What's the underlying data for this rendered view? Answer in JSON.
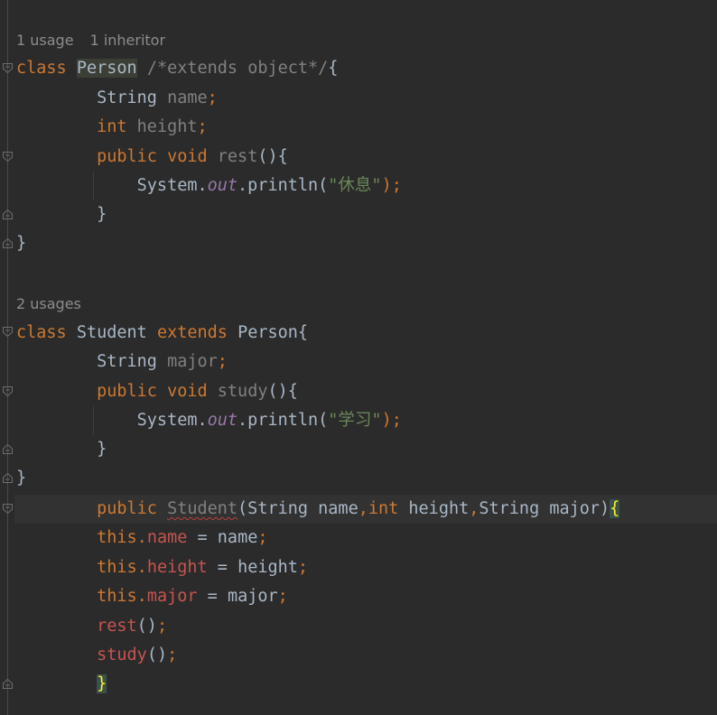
{
  "editor": {
    "inlay_person": {
      "usages": "1 usage",
      "inheritors": "1 inheritor"
    },
    "inlay_student": {
      "usages": "2 usages"
    },
    "code": {
      "class_kw": "class",
      "person": "Person",
      "comment_extends": "/*extends object*/",
      "brace_open": "{",
      "brace_close": "}",
      "string_type": "String",
      "name_field": "name",
      "int_kw": "int",
      "height_field": "height",
      "public_kw": "public",
      "void_kw": "void",
      "rest_method": "rest",
      "study_method": "study",
      "parens_open": "(){",
      "system": "System.",
      "out": "out",
      "println": ".println(",
      "str_rest": "\"休息\"",
      "str_study": "\"学习\"",
      "close_call": ");",
      "student": "Student",
      "extends_kw": "extends",
      "major_field": "major",
      "semi": ";",
      "this_kw": "this",
      "dot": ".",
      "assign": " = ",
      "name_param": "name",
      "height_param": "height",
      "major_param": "major",
      "ctor_params_1": "(String name",
      "comma": ",",
      "ctor_params_2": " height",
      "ctor_params_3": "String major)",
      "call_parens": "()"
    }
  }
}
